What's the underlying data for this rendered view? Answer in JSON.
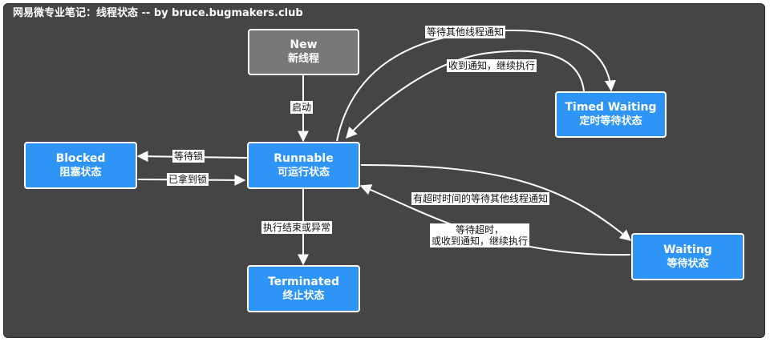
{
  "title": "网易微专业笔记：线程状态 -- by bruce.bugmakers.club",
  "colors": {
    "background": "#454545",
    "state_node": "#2e95f7",
    "new_node": "#777777",
    "edge": "#ffffff"
  },
  "nodes": {
    "new": {
      "title": "New",
      "subtitle": "新线程"
    },
    "runnable": {
      "title": "Runnable",
      "subtitle": "可运行状态"
    },
    "blocked": {
      "title": "Blocked",
      "subtitle": "阻塞状态"
    },
    "terminated": {
      "title": "Terminated",
      "subtitle": "终止状态"
    },
    "timed_waiting": {
      "title": "Timed Waiting",
      "subtitle": "定时等待状态"
    },
    "waiting": {
      "title": "Waiting",
      "subtitle": "等待状态"
    }
  },
  "edges": {
    "start": "启动",
    "wait_lock": "等待锁",
    "got_lock": "已拿到锁",
    "finish": "执行结束或异常",
    "wait_notify_timed": "等待其他线程通知",
    "notified_timed": "收到通知，继续执行",
    "wait_with_timeout": "有超时时间的等待其他线程通知",
    "timeout_line1": "等待超时，",
    "timeout_line2": "或收到通知，继续执行"
  }
}
